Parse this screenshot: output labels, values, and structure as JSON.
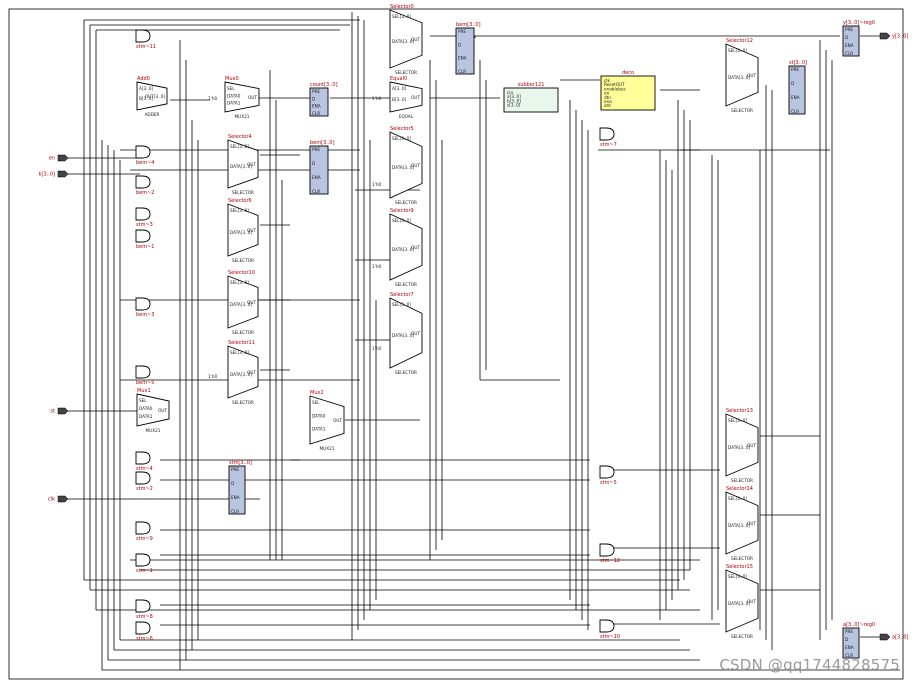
{
  "watermark": "CSDN @qq1744828575",
  "inputs": [
    {
      "id": "en",
      "label": "en"
    },
    {
      "id": "k",
      "label": "k[3..0]"
    },
    {
      "id": "st",
      "label": "st"
    },
    {
      "id": "clk",
      "label": "clk"
    }
  ],
  "outputs": [
    {
      "id": "y",
      "label": "y[3..0]"
    },
    {
      "id": "a",
      "label": "a[3..0]"
    }
  ],
  "blocks": [
    {
      "id": "add0",
      "label": "Add0",
      "sub": "ADDER",
      "ports": [
        "A[3..0]",
        "B[3..0]",
        "OUT[3..0]"
      ]
    },
    {
      "id": "mux0",
      "label": "Mux0",
      "sub": "MUX21",
      "ports": [
        "SEL",
        "DATA0",
        "DATA1",
        "OUT"
      ]
    },
    {
      "id": "mux1",
      "label": "Mux1",
      "sub": "MUX21",
      "ports": [
        "SEL",
        "DATA0",
        "DATA1",
        "OUT"
      ]
    },
    {
      "id": "mux2",
      "label": "Mux2",
      "sub": "MUX21",
      "ports": [
        "SEL",
        "DATA0",
        "DATA1",
        "OUT"
      ]
    },
    {
      "id": "sel4",
      "label": "Selector4",
      "sub": "SELECTOR",
      "ports": [
        "SEL[3..0]",
        "DATA[3..0]",
        "OUT"
      ]
    },
    {
      "id": "sel6",
      "label": "Selector6",
      "sub": "SELECTOR",
      "ports": [
        "SEL[3..0]",
        "DATA[3..0]",
        "OUT"
      ]
    },
    {
      "id": "sel10",
      "label": "Selector10",
      "sub": "SELECTOR",
      "ports": [
        "SEL[3..0]",
        "DATA[3..0]",
        "OUT"
      ]
    },
    {
      "id": "sel11",
      "label": "Selector11",
      "sub": "SELECTOR",
      "ports": [
        "SEL[3..0]",
        "DATA[3..0]",
        "OUT"
      ]
    },
    {
      "id": "sel0",
      "label": "Selector0",
      "sub": "SELECTOR",
      "ports": [
        "SEL[3..0]",
        "DATA[3..0]",
        "OUT"
      ]
    },
    {
      "id": "equal0",
      "label": "Equal0",
      "sub": "EQUAL",
      "ports": [
        "A[3..0]",
        "B[3..0]",
        "OUT"
      ]
    },
    {
      "id": "sel5",
      "label": "Selector5",
      "sub": "SELECTOR",
      "ports": [
        "SEL[3..0]",
        "DATA[3..0]",
        "OUT"
      ]
    },
    {
      "id": "sel9",
      "label": "Selector9",
      "sub": "SELECTOR",
      "ports": [
        "SEL[3..0]",
        "DATA[3..0]",
        "OUT"
      ]
    },
    {
      "id": "sel7",
      "label": "Selector7",
      "sub": "SELECTOR",
      "ports": [
        "SEL[3..0]",
        "DATA[3..0]",
        "OUT"
      ]
    },
    {
      "id": "sel12",
      "label": "Selector12",
      "sub": "SELECTOR",
      "ports": [
        "SEL[3..0]",
        "DATA[3..0]",
        "OUT"
      ]
    },
    {
      "id": "sel13",
      "label": "Selector13",
      "sub": "SELECTOR",
      "ports": [
        "SEL[3..0]",
        "DATA[3..0]",
        "OUT"
      ]
    },
    {
      "id": "sel14",
      "label": "Selector14",
      "sub": "SELECTOR",
      "ports": [
        "SEL[3..0]",
        "DATA[3..0]",
        "OUT"
      ]
    },
    {
      "id": "sel15",
      "label": "Selector15",
      "sub": "SELECTOR",
      "ports": [
        "SEL[3..0]",
        "DATA[3..0]",
        "OUT"
      ]
    },
    {
      "id": "sub121",
      "label": "subber121",
      "sub": "",
      "ports": [
        "cin",
        "a[3..0]",
        "b[3..0]",
        "s[3..0]"
      ]
    },
    {
      "id": "deco",
      "label": "deco",
      "sub": "",
      "ports": [
        "clk",
        "ResetOUT",
        "enablebus",
        "en",
        "dtn",
        "ena",
        "dnt"
      ]
    }
  ],
  "registers": [
    {
      "id": "count",
      "label": "count[3..0]",
      "ports": [
        "PRE",
        "D",
        "ENA",
        "CLR"
      ]
    },
    {
      "id": "bem",
      "label": "bem[3..0]",
      "ports": [
        "PRE",
        "D",
        "ENA",
        "CLR"
      ]
    },
    {
      "id": "beta",
      "label": "bem[3..0]",
      "ports": [
        "PRE",
        "D",
        "ENA",
        "CLR"
      ]
    },
    {
      "id": "stm",
      "label": "stm[3..0]",
      "ports": [
        "PRE",
        "D",
        "ENA",
        "CLR"
      ]
    },
    {
      "id": "st2",
      "label": "st[3..0]",
      "ports": [
        "PRE",
        "D",
        "ENA",
        "CLR"
      ]
    },
    {
      "id": "yreg",
      "label": "y[3..0]~reg0",
      "ports": [
        "PRE",
        "D",
        "ENA",
        "CLR"
      ]
    },
    {
      "id": "areg",
      "label": "a[3..0]~reg0",
      "ports": [
        "PRE",
        "D",
        "ENA",
        "CLR"
      ]
    }
  ],
  "gates": [
    "stm~11",
    "bem~4",
    "bem~2",
    "stm~3",
    "bem~1",
    "bem~3",
    "bem~5",
    "stm~4",
    "stm~2",
    "stm~9",
    "stm~1",
    "stm~8",
    "stm~6",
    "stm~7",
    "stm~5",
    "stm~12",
    "stm~10"
  ],
  "wire_label": "1'h0"
}
